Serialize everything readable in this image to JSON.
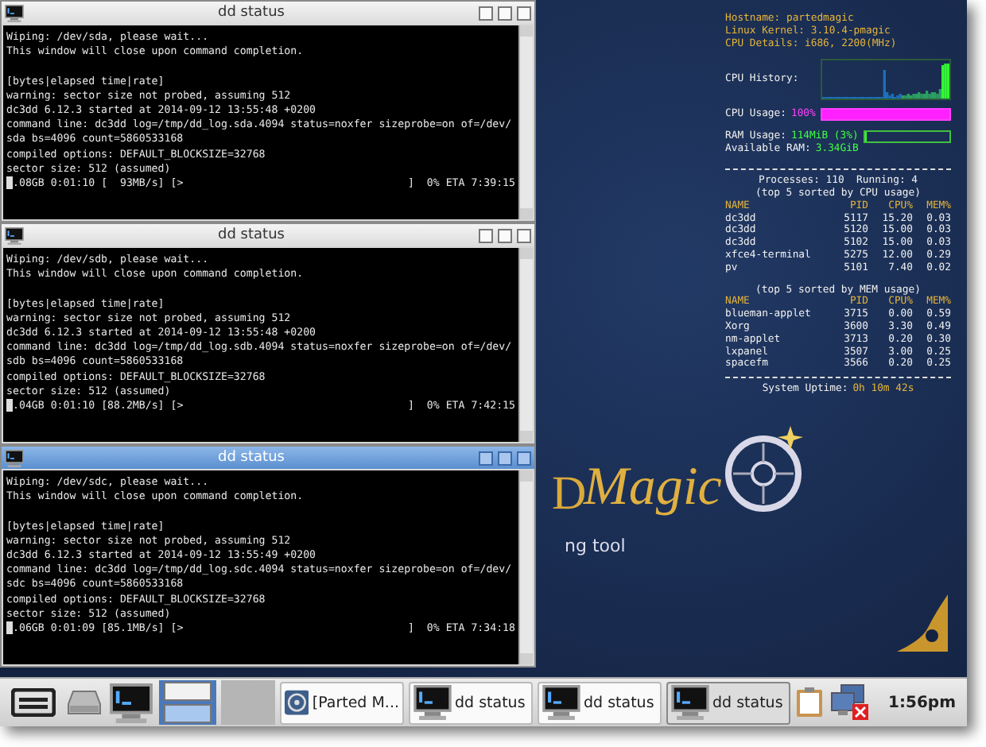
{
  "windows": [
    {
      "title": "dd status",
      "active": false,
      "notice": [
        "Wiping: /dev/sda, please wait...",
        "This window will close upon command completion."
      ],
      "lines": [
        "[bytes|elapsed time|rate]",
        "warning: sector size not probed, assuming 512",
        "dc3dd 6.12.3 started at 2014-09-12 13:55:48 +0200",
        "command line: dc3dd log=/tmp/dd_log.sda.4094 status=noxfer sizeprobe=on of=/dev/",
        "sda bs=4096 count=5860533168",
        "compiled options: DEFAULT_BLOCKSIZE=32768",
        "sector size: 512 (assumed)"
      ],
      "progress": {
        "left": ".08GB 0:01:10 [  93MB/s] [>",
        "right": "]  0% ETA 7:39:15"
      }
    },
    {
      "title": "dd status",
      "active": false,
      "notice": [
        "Wiping: /dev/sdb, please wait...",
        "This window will close upon command completion."
      ],
      "lines": [
        "[bytes|elapsed time|rate]",
        "warning: sector size not probed, assuming 512",
        "dc3dd 6.12.3 started at 2014-09-12 13:55:48 +0200",
        "command line: dc3dd log=/tmp/dd_log.sdb.4094 status=noxfer sizeprobe=on of=/dev/",
        "sdb bs=4096 count=5860533168",
        "compiled options: DEFAULT_BLOCKSIZE=32768",
        "sector size: 512 (assumed)"
      ],
      "progress": {
        "left": ".04GB 0:01:10 [88.2MB/s] [>",
        "right": "]  0% ETA 7:42:15"
      }
    },
    {
      "title": "dd status",
      "active": true,
      "notice": [
        "Wiping: /dev/sdc, please wait...",
        "This window will close upon command completion."
      ],
      "lines": [
        "[bytes|elapsed time|rate]",
        "warning: sector size not probed, assuming 512",
        "dc3dd 6.12.3 started at 2014-09-12 13:55:49 +0200",
        "command line: dc3dd log=/tmp/dd_log.sdc.4094 status=noxfer sizeprobe=on of=/dev/",
        "sdc bs=4096 count=5860533168",
        "compiled options: DEFAULT_BLOCKSIZE=32768",
        "sector size: 512 (assumed)"
      ],
      "progress": {
        "left": ".06GB 0:01:09 [85.1MB/s] [>",
        "right": "]  0% ETA 7:34:18"
      }
    }
  ],
  "logo": {
    "letter": "D",
    "title": "Magic",
    "tagline": "ng tool"
  },
  "conky": {
    "info": [
      "Hostname: partedmagic",
      "Linux Kernel: 3.10.4-pmagic",
      "CPU Details: i686, 2200(MHz)"
    ],
    "cpu_history_label": "CPU History:",
    "cpu_usage": {
      "label": "CPU Usage:",
      "value": "100%",
      "level": 1
    },
    "ram_usage": {
      "label": "RAM Usage:",
      "value": "114MiB (3%)",
      "level": 0.03
    },
    "available_ram": {
      "label": "Available RAM:",
      "value": "3.34GiB"
    },
    "processes": "Processes: 110  Running: 4",
    "cpu_table": {
      "caption": "(top 5 sorted by CPU usage)",
      "columns": [
        "NAME",
        "PID",
        "CPU%",
        "MEM%"
      ],
      "rows": [
        [
          "dc3dd",
          "5117",
          "15.20",
          "0.03"
        ],
        [
          "dc3dd",
          "5120",
          "15.00",
          "0.03"
        ],
        [
          "dc3dd",
          "5102",
          "15.00",
          "0.03"
        ],
        [
          "xfce4-terminal",
          "5275",
          "12.00",
          "0.29"
        ],
        [
          "pv",
          "5101",
          "7.40",
          "0.02"
        ]
      ]
    },
    "mem_table": {
      "caption": "(top 5 sorted by MEM usage)",
      "columns": [
        "NAME",
        "PID",
        "CPU%",
        "MEM%"
      ],
      "rows": [
        [
          "blueman-applet",
          "3715",
          "0.00",
          "0.59"
        ],
        [
          "Xorg",
          "3600",
          "3.30",
          "0.49"
        ],
        [
          "nm-applet",
          "3713",
          "0.20",
          "0.30"
        ],
        [
          "lxpanel",
          "3507",
          "3.00",
          "0.25"
        ],
        [
          "spacefm",
          "3566",
          "0.20",
          "0.25"
        ]
      ]
    },
    "uptime": {
      "label": "System Uptime:",
      "value": "0h 10m 42s"
    }
  },
  "taskbar": {
    "desktops": [
      {
        "selected": false
      },
      {
        "selected": true
      }
    ],
    "tasks": [
      {
        "kind": "parted",
        "label": "[Parted M...",
        "selected": false
      },
      {
        "kind": "terminal",
        "label": "dd status",
        "selected": false
      },
      {
        "kind": "terminal",
        "label": "dd status",
        "selected": false
      },
      {
        "kind": "terminal",
        "label": "dd status",
        "selected": true
      }
    ],
    "clock": "1:56pm"
  }
}
